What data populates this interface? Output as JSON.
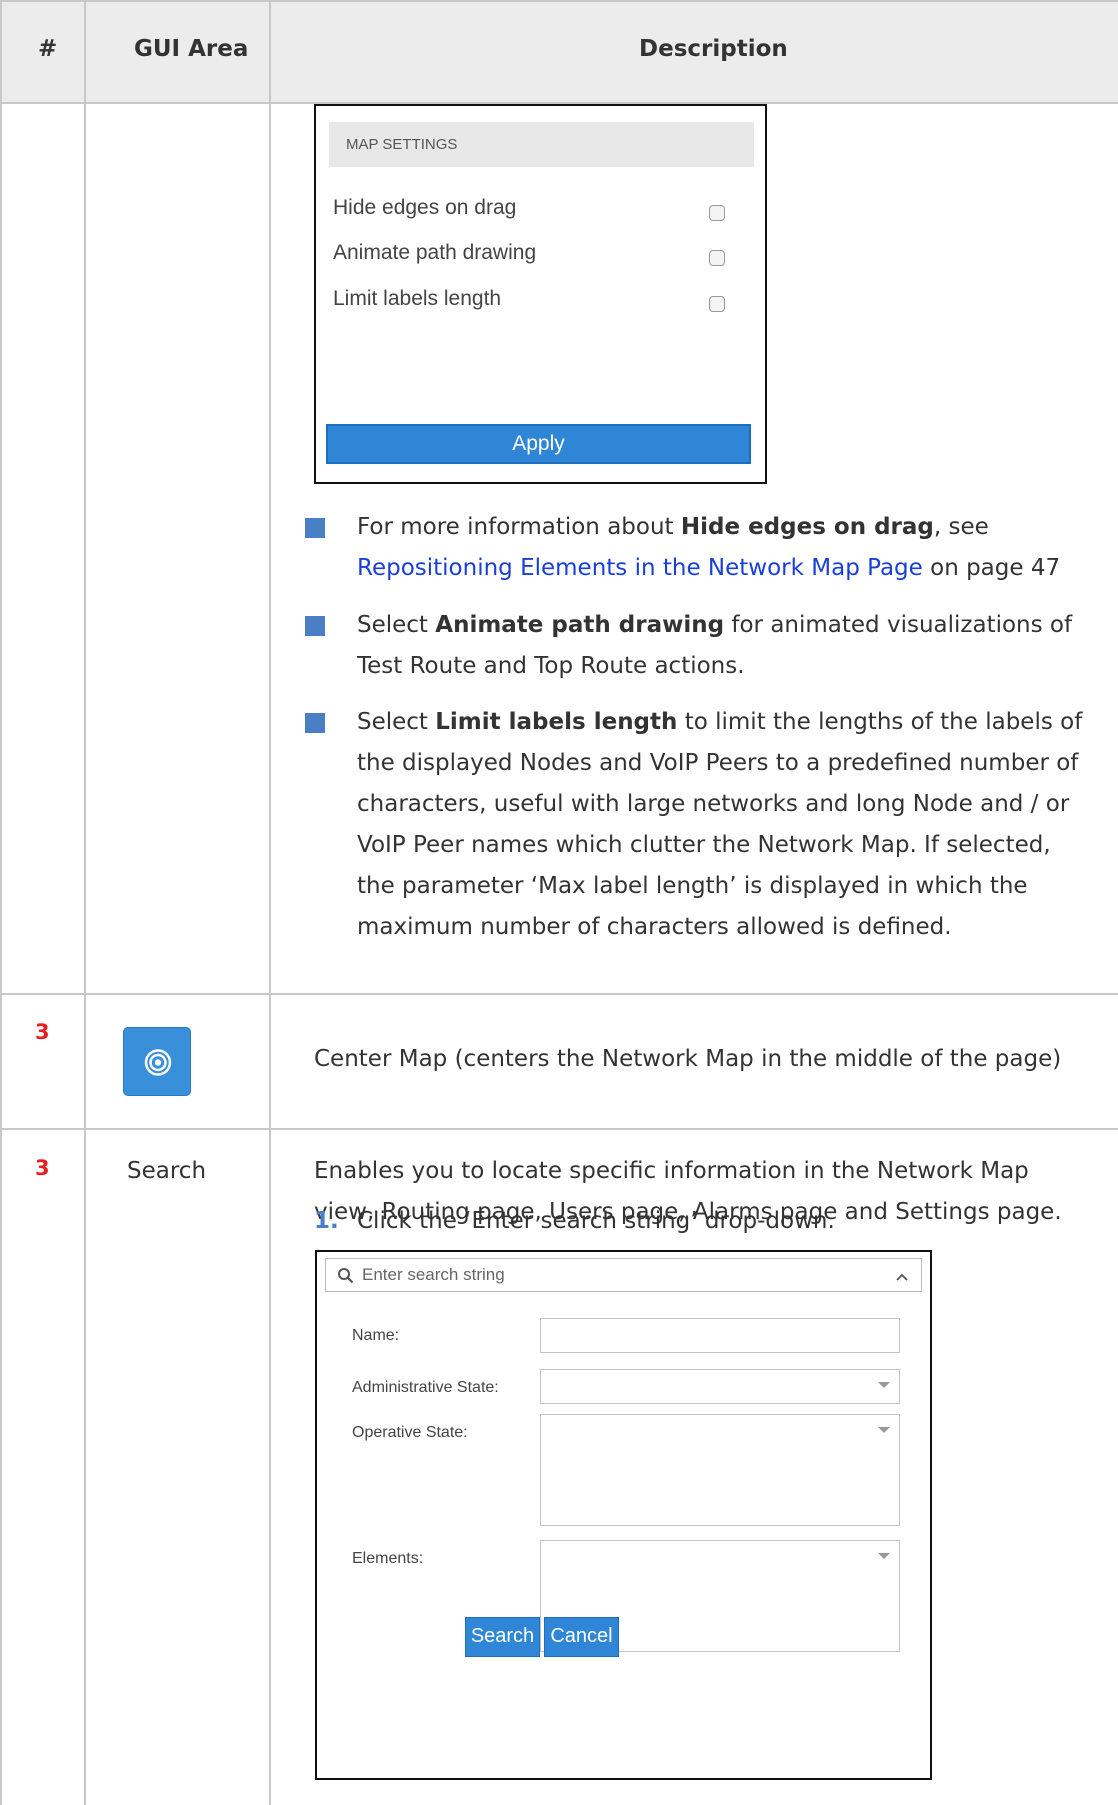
{
  "table": {
    "headers": {
      "num": "#",
      "gui_area": "GUI Area",
      "description": "Description"
    }
  },
  "map_settings": {
    "title": "MAP SETTINGS",
    "options": [
      {
        "label": "Hide edges on drag",
        "checked": false
      },
      {
        "label": "Animate path drawing",
        "checked": false
      },
      {
        "label": "Limit labels length",
        "checked": false
      }
    ],
    "apply_label": "Apply"
  },
  "bullets": {
    "b1": {
      "pre": "For more information about ",
      "bold": "Hide edges on drag",
      "mid": ", see",
      "link": "Repositioning Elements in the Network Map Page",
      "post": " on page 47"
    },
    "b2": {
      "pre": "Select ",
      "bold": "Animate path drawing",
      "post1": " for animated visualizations of",
      "line2": "Test Route and Top Route actions."
    },
    "b3": {
      "pre": "Select ",
      "bold": "Limit labels length",
      "post1": " to limit the lengths of the labels of",
      "lines": [
        "the displayed Nodes and VoIP Peers to a predefined number of",
        "characters, useful with large networks and long Node and / or",
        "VoIP Peer names which clutter the Network Map. If selected,",
        "the parameter ‘Max label length’ is displayed in which the",
        "maximum number of characters allowed is defined."
      ]
    }
  },
  "row_center": {
    "num": "3",
    "description": "Center Map (centers the Network Map in the middle of the page)"
  },
  "row_search": {
    "num": "3",
    "gui_area": "Search",
    "desc_line1": "Enables you to locate specific information in the Network Map",
    "desc_line2": "view, Routing page, Users page, Alarms page and Settings page.",
    "step_num": "1.",
    "step_text": "Click the ‘Enter search string’ drop-down."
  },
  "search_panel": {
    "placeholder": "Enter search string",
    "labels": {
      "name": "Name:",
      "admin_state": "Administrative State:",
      "operative_state": "Operative State:",
      "elements": "Elements:"
    },
    "search_label": "Search",
    "cancel_label": "Cancel"
  },
  "colors": {
    "accent_blue": "#2f86d6",
    "bullet_blue": "#4a7fc6",
    "link_blue": "#1a3fd8",
    "red_number": "#e41f1f"
  }
}
